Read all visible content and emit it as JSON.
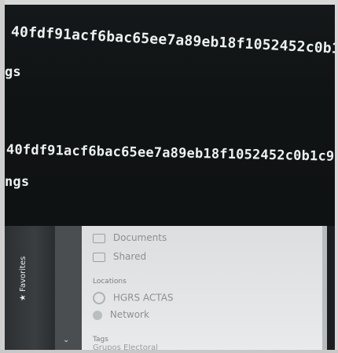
{
  "terminal": {
    "lines": [
      "40fdf91acf6bac65ee7a89eb18f1052452c0b1c",
      "gs",
      "40fdf91acf6bac65ee7a89eb18f1052452c0b1c9",
      "ngs"
    ]
  },
  "file_manager": {
    "items": {
      "documents": "Documents",
      "shared": "Shared"
    },
    "sections": {
      "locations": "Locations",
      "tags": "Tags"
    },
    "locations": {
      "drive": "HGRS ACTAS",
      "network": "Network"
    },
    "tag_items": {
      "first": "Grupos Electoral"
    },
    "sidebar_label": "Favorites"
  },
  "icons": {
    "favorite": "star-icon",
    "chevron": "chevron-down-icon",
    "folder": "folder-icon",
    "network": "network-icon",
    "drive": "drive-icon"
  },
  "colors": {
    "terminal_bg": "#101314",
    "terminal_text": "#eef1f2",
    "panel_bg": "#e3e5e6"
  }
}
